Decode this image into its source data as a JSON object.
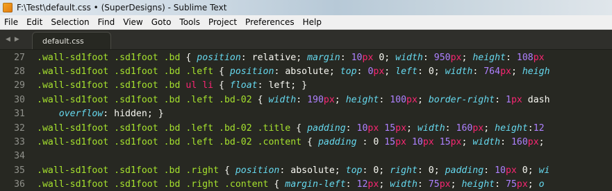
{
  "window": {
    "title": "F:\\Test\\default.css • (SuperDesigns) - Sublime Text"
  },
  "menu": [
    "File",
    "Edit",
    "Selection",
    "Find",
    "View",
    "Goto",
    "Tools",
    "Project",
    "Preferences",
    "Help"
  ],
  "tab": {
    "label": "default.css",
    "nav_left": "◀",
    "nav_right": "▶"
  },
  "code_lines": [
    {
      "num": "27",
      "tokens": [
        {
          "t": ".wall-sd1foot .sd1foot .bd ",
          "c": "sel"
        },
        {
          "t": "{ ",
          "c": "punct"
        },
        {
          "t": "position",
          "c": "prop"
        },
        {
          "t": ": relative; ",
          "c": "val"
        },
        {
          "t": "margin",
          "c": "prop"
        },
        {
          "t": ": ",
          "c": "val"
        },
        {
          "t": "10",
          "c": "num"
        },
        {
          "t": "px",
          "c": "unit"
        },
        {
          "t": " 0; ",
          "c": "val"
        },
        {
          "t": "width",
          "c": "prop"
        },
        {
          "t": ": ",
          "c": "val"
        },
        {
          "t": "950",
          "c": "num"
        },
        {
          "t": "px",
          "c": "unit"
        },
        {
          "t": "; ",
          "c": "val"
        },
        {
          "t": "height",
          "c": "prop"
        },
        {
          "t": ": ",
          "c": "val"
        },
        {
          "t": "108",
          "c": "num"
        },
        {
          "t": "px",
          "c": "unit"
        }
      ]
    },
    {
      "num": "28",
      "tokens": [
        {
          "t": ".wall-sd1foot .sd1foot .bd .left ",
          "c": "sel"
        },
        {
          "t": "{ ",
          "c": "punct"
        },
        {
          "t": "position",
          "c": "prop"
        },
        {
          "t": ": absolute; ",
          "c": "val"
        },
        {
          "t": "top",
          "c": "prop"
        },
        {
          "t": ": ",
          "c": "val"
        },
        {
          "t": "0",
          "c": "num"
        },
        {
          "t": "px",
          "c": "unit"
        },
        {
          "t": "; ",
          "c": "val"
        },
        {
          "t": "left",
          "c": "prop"
        },
        {
          "t": ": 0; ",
          "c": "val"
        },
        {
          "t": "width",
          "c": "prop"
        },
        {
          "t": ": ",
          "c": "val"
        },
        {
          "t": "764",
          "c": "num"
        },
        {
          "t": "px",
          "c": "unit"
        },
        {
          "t": "; ",
          "c": "val"
        },
        {
          "t": "heigh",
          "c": "prop"
        }
      ]
    },
    {
      "num": "29",
      "tokens": [
        {
          "t": ".wall-sd1foot .sd1foot .bd ",
          "c": "sel"
        },
        {
          "t": "ul li ",
          "c": "tag"
        },
        {
          "t": "{ ",
          "c": "punct"
        },
        {
          "t": "float",
          "c": "prop"
        },
        {
          "t": ": left; }",
          "c": "val"
        }
      ]
    },
    {
      "num": "30",
      "tokens": [
        {
          "t": ".wall-sd1foot .sd1foot .bd .left .bd-02 ",
          "c": "sel"
        },
        {
          "t": "{ ",
          "c": "punct"
        },
        {
          "t": "width",
          "c": "prop"
        },
        {
          "t": ": ",
          "c": "val"
        },
        {
          "t": "190",
          "c": "num"
        },
        {
          "t": "px",
          "c": "unit"
        },
        {
          "t": "; ",
          "c": "val"
        },
        {
          "t": "height",
          "c": "prop"
        },
        {
          "t": ": ",
          "c": "val"
        },
        {
          "t": "100",
          "c": "num"
        },
        {
          "t": "px",
          "c": "unit"
        },
        {
          "t": "; ",
          "c": "val"
        },
        {
          "t": "border-right",
          "c": "prop"
        },
        {
          "t": ": ",
          "c": "val"
        },
        {
          "t": "1",
          "c": "num"
        },
        {
          "t": "px",
          "c": "unit"
        },
        {
          "t": " dash",
          "c": "val"
        }
      ]
    },
    {
      "num": "31",
      "tokens": [
        {
          "t": "    ",
          "c": "val"
        },
        {
          "t": "overflow",
          "c": "prop"
        },
        {
          "t": ": hidden; }",
          "c": "val"
        }
      ]
    },
    {
      "num": "32",
      "tokens": [
        {
          "t": ".wall-sd1foot .sd1foot .bd .left .bd-02 .title ",
          "c": "sel"
        },
        {
          "t": "{ ",
          "c": "punct"
        },
        {
          "t": "padding",
          "c": "prop"
        },
        {
          "t": ": ",
          "c": "val"
        },
        {
          "t": "10",
          "c": "num"
        },
        {
          "t": "px",
          "c": "unit"
        },
        {
          "t": " ",
          "c": "val"
        },
        {
          "t": "15",
          "c": "num"
        },
        {
          "t": "px",
          "c": "unit"
        },
        {
          "t": "; ",
          "c": "val"
        },
        {
          "t": "width",
          "c": "prop"
        },
        {
          "t": ": ",
          "c": "val"
        },
        {
          "t": "160",
          "c": "num"
        },
        {
          "t": "px",
          "c": "unit"
        },
        {
          "t": "; ",
          "c": "val"
        },
        {
          "t": "height",
          "c": "prop"
        },
        {
          "t": ":",
          "c": "val"
        },
        {
          "t": "12",
          "c": "num"
        }
      ]
    },
    {
      "num": "33",
      "tokens": [
        {
          "t": ".wall-sd1foot .sd1foot .bd .left .bd-02 .content ",
          "c": "sel"
        },
        {
          "t": "{ ",
          "c": "punct"
        },
        {
          "t": "padding",
          "c": "prop"
        },
        {
          "t": " : 0 ",
          "c": "val"
        },
        {
          "t": "15",
          "c": "num"
        },
        {
          "t": "px",
          "c": "unit"
        },
        {
          "t": " ",
          "c": "val"
        },
        {
          "t": "10",
          "c": "num"
        },
        {
          "t": "px",
          "c": "unit"
        },
        {
          "t": " ",
          "c": "val"
        },
        {
          "t": "15",
          "c": "num"
        },
        {
          "t": "px",
          "c": "unit"
        },
        {
          "t": "; ",
          "c": "val"
        },
        {
          "t": "width",
          "c": "prop"
        },
        {
          "t": ": ",
          "c": "val"
        },
        {
          "t": "160",
          "c": "num"
        },
        {
          "t": "px",
          "c": "unit"
        },
        {
          "t": ";",
          "c": "val"
        }
      ]
    },
    {
      "num": "34",
      "tokens": []
    },
    {
      "num": "35",
      "tokens": [
        {
          "t": ".wall-sd1foot .sd1foot .bd .right ",
          "c": "sel"
        },
        {
          "t": "{ ",
          "c": "punct"
        },
        {
          "t": "position",
          "c": "prop"
        },
        {
          "t": ": absolute; ",
          "c": "val"
        },
        {
          "t": "top",
          "c": "prop"
        },
        {
          "t": ": 0; ",
          "c": "val"
        },
        {
          "t": "right",
          "c": "prop"
        },
        {
          "t": ": 0; ",
          "c": "val"
        },
        {
          "t": "padding",
          "c": "prop"
        },
        {
          "t": ": ",
          "c": "val"
        },
        {
          "t": "10",
          "c": "num"
        },
        {
          "t": "px",
          "c": "unit"
        },
        {
          "t": " 0; ",
          "c": "val"
        },
        {
          "t": "wi",
          "c": "prop"
        }
      ]
    },
    {
      "num": "36",
      "tokens": [
        {
          "t": ".wall-sd1foot .sd1foot .bd .right .content ",
          "c": "sel"
        },
        {
          "t": "{ ",
          "c": "punct"
        },
        {
          "t": "margin-left",
          "c": "prop"
        },
        {
          "t": ": ",
          "c": "val"
        },
        {
          "t": "12",
          "c": "num"
        },
        {
          "t": "px",
          "c": "unit"
        },
        {
          "t": "; ",
          "c": "val"
        },
        {
          "t": "width",
          "c": "prop"
        },
        {
          "t": ": ",
          "c": "val"
        },
        {
          "t": "75",
          "c": "num"
        },
        {
          "t": "px",
          "c": "unit"
        },
        {
          "t": "; ",
          "c": "val"
        },
        {
          "t": "height",
          "c": "prop"
        },
        {
          "t": ": ",
          "c": "val"
        },
        {
          "t": "75",
          "c": "num"
        },
        {
          "t": "px",
          "c": "unit"
        },
        {
          "t": "; ",
          "c": "val"
        },
        {
          "t": "o",
          "c": "prop"
        }
      ]
    }
  ]
}
